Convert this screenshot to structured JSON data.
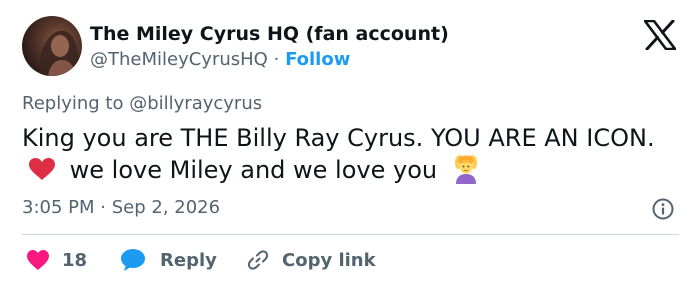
{
  "author": {
    "name": "The Miley Cyrus HQ (fan account)",
    "handle": "@TheMileyCyrusHQ",
    "separator": "·",
    "follow_label": "Follow"
  },
  "reply_context": {
    "prefix": "Replying to",
    "mention": "@billyraycyrus"
  },
  "tweet": {
    "text_part1": "King you are THE Billy Ray Cyrus. YOU ARE AN ICON.",
    "text_part2": "we love Miley and we love you"
  },
  "meta": {
    "time": "3:05 PM",
    "separator": "·",
    "date": "Sep 2, 2026"
  },
  "actions": {
    "like_count": "18",
    "reply_label": "Reply",
    "copy_label": "Copy link"
  },
  "icons": {
    "brand": "x-logo",
    "like": "heart-icon",
    "reply": "speech-bubble-icon",
    "copy": "link-icon",
    "info": "info-icon"
  },
  "colors": {
    "link_blue": "#1d9bf0",
    "like_pink": "#f91880",
    "secondary_text": "#536471",
    "heart_emoji": "#dd2e44"
  }
}
